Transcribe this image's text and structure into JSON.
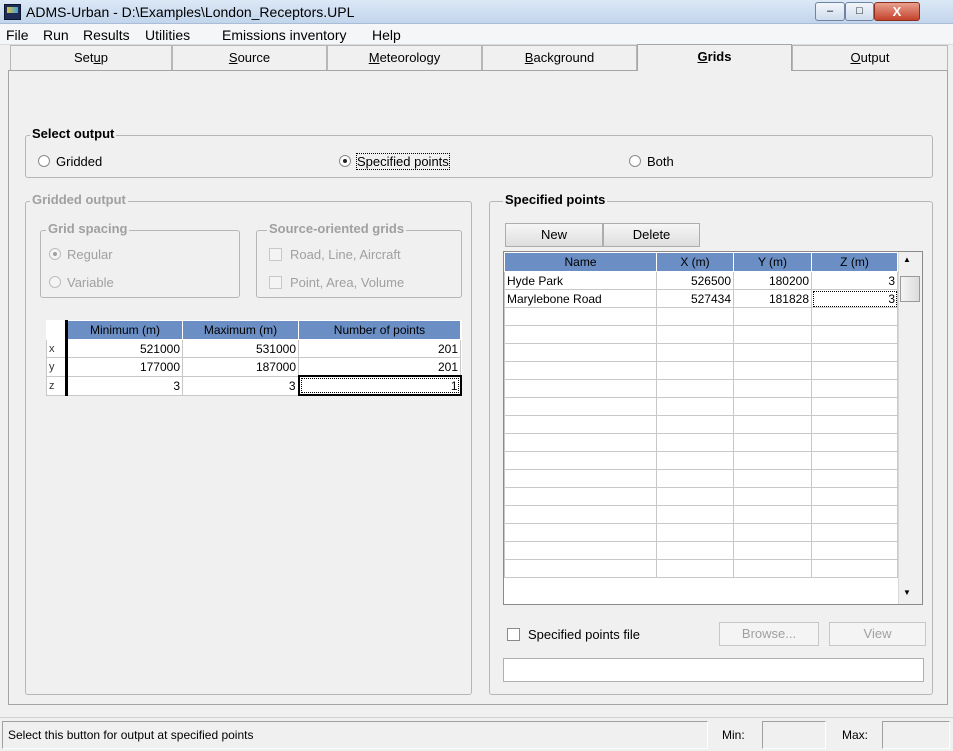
{
  "window": {
    "title": "ADMS-Urban - D:\\Examples\\London_Receptors.UPL",
    "min_label": "‒",
    "max_label": "□",
    "close_label": "X"
  },
  "menu": [
    "File",
    "Run",
    "Results",
    "Utilities",
    "Emissions inventory",
    "Help"
  ],
  "tabs": [
    {
      "label": "Setup",
      "active": false
    },
    {
      "label": "Source",
      "active": false
    },
    {
      "label": "Meteorology",
      "active": false
    },
    {
      "label": "Background",
      "active": false
    },
    {
      "label": "Grids",
      "active": true
    },
    {
      "label": "Output",
      "active": false
    }
  ],
  "select_output": {
    "legend": "Select output",
    "options": [
      "Gridded",
      "Specified points",
      "Both"
    ],
    "selected": "Specified points"
  },
  "gridded_output": {
    "legend": "Gridded output",
    "grid_spacing": {
      "legend": "Grid spacing",
      "options": [
        "Regular",
        "Variable"
      ],
      "selected": "Regular"
    },
    "source_oriented": {
      "legend": "Source-oriented grids",
      "options": [
        "Road, Line, Aircraft",
        "Point, Area, Volume"
      ]
    },
    "table": {
      "headers": [
        "Minimum (m)",
        "Maximum (m)",
        "Number of points"
      ],
      "rows": [
        {
          "axis": "x",
          "min": "521000",
          "max": "531000",
          "n": "201"
        },
        {
          "axis": "y",
          "min": "177000",
          "max": "187000",
          "n": "201"
        },
        {
          "axis": "z",
          "min": "3",
          "max": "3",
          "n": "1"
        }
      ]
    }
  },
  "specified_points": {
    "legend": "Specified points",
    "new_label": "New",
    "delete_label": "Delete",
    "headers": [
      "Name",
      "X (m)",
      "Y (m)",
      "Z (m)"
    ],
    "rows": [
      {
        "name": "Hyde Park",
        "x": "526500",
        "y": "180200",
        "z": "3"
      },
      {
        "name": "Marylebone Road",
        "x": "527434",
        "y": "181828",
        "z": "3"
      }
    ],
    "empty_rows": 15,
    "file_label": "Specified points file",
    "browse_label": "Browse...",
    "view_label": "View",
    "file_path": ""
  },
  "status": {
    "message": "Select this button for output at specified points",
    "min_label": "Min:",
    "max_label": "Max:",
    "min_value": "",
    "max_value": ""
  }
}
